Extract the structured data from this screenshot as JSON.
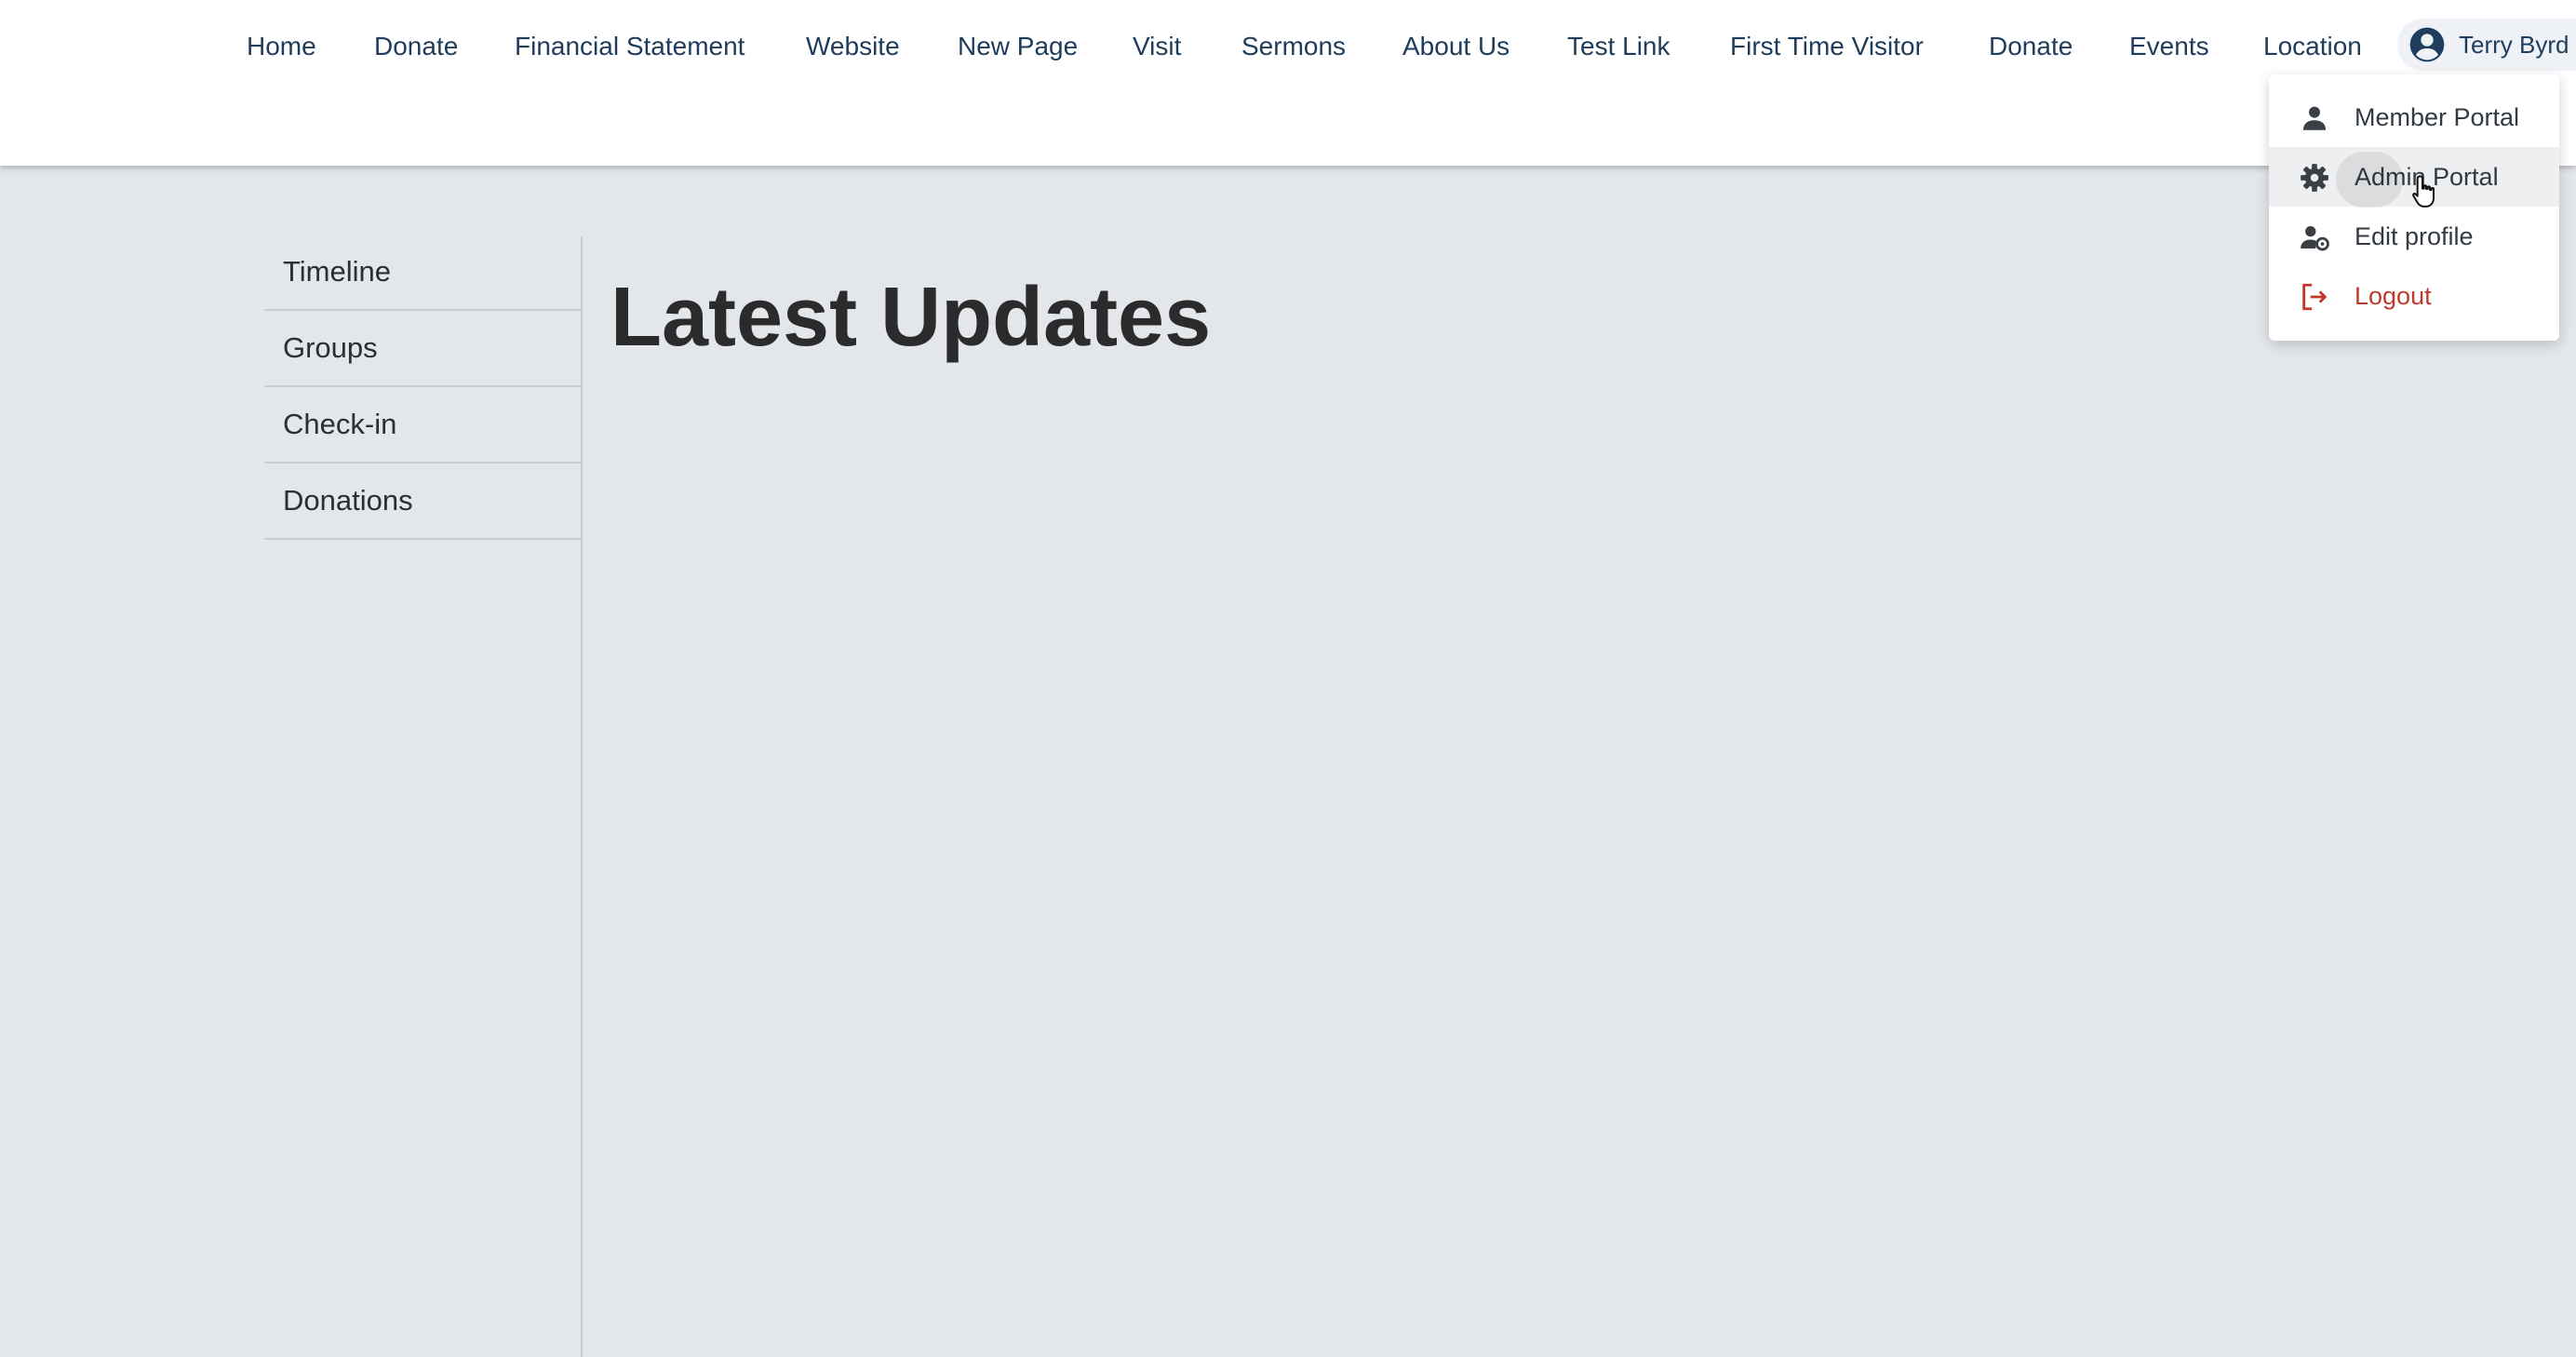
{
  "nav": {
    "links": [
      "Home",
      "Donate",
      "Financial Statement",
      "Website",
      "New Page",
      "Visit",
      "Sermons",
      "About Us",
      "Test Link",
      "First Time Visitor",
      "Donate",
      "Events",
      "Location"
    ],
    "user_name": "Terry Byrd",
    "user_icon": "account-circle-icon"
  },
  "dropdown": {
    "items": [
      {
        "label": "Member Portal",
        "icon": "person-icon"
      },
      {
        "label": "Admin Portal",
        "icon": "gear-icon"
      },
      {
        "label": "Edit profile",
        "icon": "user-cog-icon"
      },
      {
        "label": "Logout",
        "icon": "logout-icon"
      }
    ],
    "hovered_item": "Admin Portal"
  },
  "sidebar": {
    "items": [
      "Timeline",
      "Groups",
      "Check-in",
      "Donations"
    ]
  },
  "main": {
    "title": "Latest Updates"
  },
  "colors": {
    "nav_text": "#1e3d5c",
    "background": "#e3e6eb",
    "logout": "#c0392b"
  }
}
